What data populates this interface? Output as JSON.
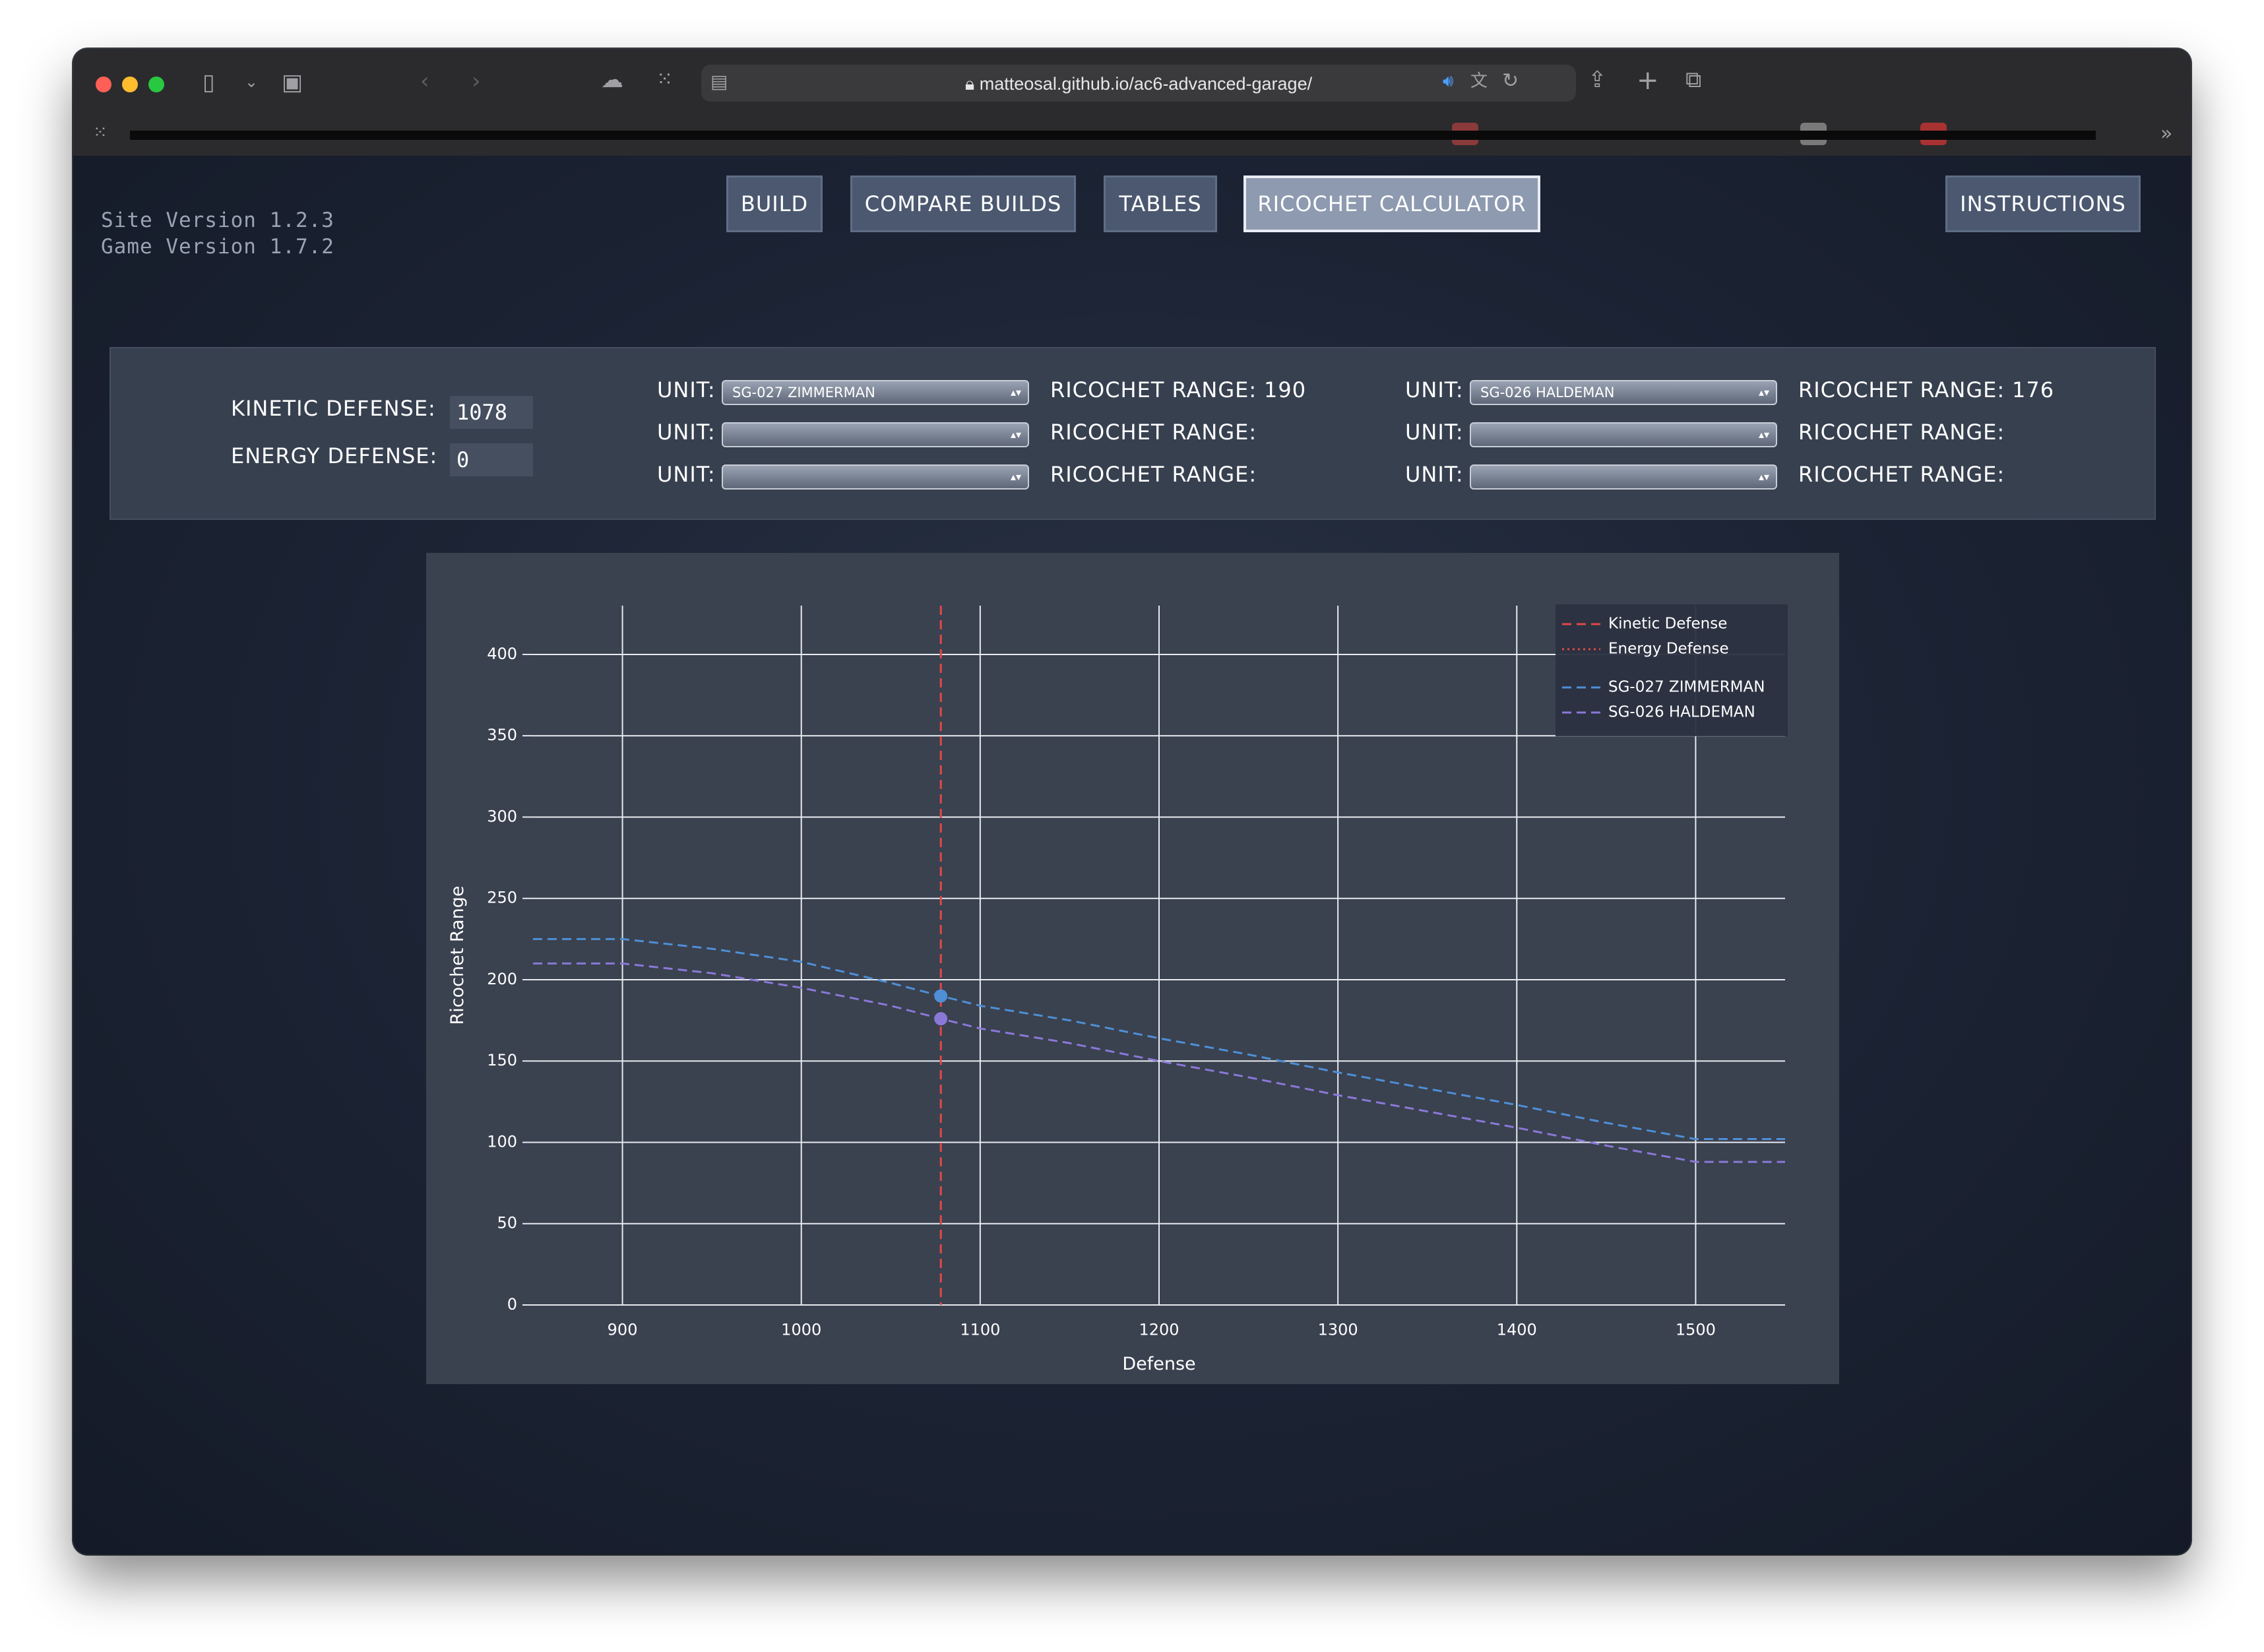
{
  "browser": {
    "url": "matteosal.github.io/ac6-advanced-garage/"
  },
  "site": {
    "site_version": "Site Version 1.2.3",
    "game_version": "Game Version 1.7.2"
  },
  "nav": {
    "build": "BUILD",
    "compare": "COMPARE BUILDS",
    "tables": "TABLES",
    "ricochet": "RICOCHET CALCULATOR",
    "instructions": "INSTRUCTIONS"
  },
  "controls": {
    "kinetic_label": "KINETIC DEFENSE:",
    "kinetic_value": "1078",
    "energy_label": "ENERGY DEFENSE:",
    "energy_value": "0",
    "unit_label": "UNIT:",
    "range_label": "RICOCHET RANGE:",
    "left": [
      {
        "unit": "SG-027 ZIMMERMAN",
        "range": "190"
      },
      {
        "unit": "",
        "range": ""
      },
      {
        "unit": "",
        "range": ""
      }
    ],
    "right": [
      {
        "unit": "SG-026 HALDEMAN",
        "range": "176"
      },
      {
        "unit": "",
        "range": ""
      },
      {
        "unit": "",
        "range": ""
      }
    ]
  },
  "chart_data": {
    "type": "line",
    "xlabel": "Defense",
    "ylabel": "Ricochet Range",
    "xlim": [
      850,
      1550
    ],
    "ylim": [
      0,
      430
    ],
    "xticks": [
      900,
      1000,
      1100,
      1200,
      1300,
      1400,
      1500
    ],
    "yticks": [
      0,
      50,
      100,
      150,
      200,
      250,
      300,
      350,
      400
    ],
    "grid": true,
    "legend_position": "top-right",
    "legend": [
      "Kinetic Defense",
      "Energy Defense",
      "SG-027 ZIMMERMAN",
      "SG-026 HALDEMAN"
    ],
    "vlines": [
      {
        "name": "Kinetic Defense",
        "x": 1078,
        "color": "#e04848",
        "dash": "dashed"
      },
      {
        "name": "Energy Defense",
        "x": 0,
        "color": "#e04848",
        "dash": "dotted"
      }
    ],
    "series": [
      {
        "name": "SG-027 ZIMMERMAN",
        "color": "#4e8fd6",
        "x": [
          850,
          900,
          950,
          1000,
          1050,
          1078,
          1100,
          1150,
          1200,
          1250,
          1300,
          1350,
          1400,
          1450,
          1500,
          1550
        ],
        "y": [
          225,
          225,
          219,
          211,
          198,
          190,
          184,
          175,
          164,
          154,
          143,
          133,
          123,
          112,
          102,
          102
        ]
      },
      {
        "name": "SG-026 HALDEMAN",
        "color": "#8a78d8",
        "x": [
          850,
          900,
          950,
          1000,
          1050,
          1078,
          1100,
          1150,
          1200,
          1250,
          1300,
          1350,
          1400,
          1450,
          1500,
          1550
        ],
        "y": [
          210,
          210,
          204,
          195,
          184,
          176,
          170,
          161,
          150,
          140,
          129,
          119,
          109,
          98,
          88,
          88
        ]
      }
    ],
    "markers": [
      {
        "series": "SG-027 ZIMMERMAN",
        "x": 1078,
        "y": 190
      },
      {
        "series": "SG-026 HALDEMAN",
        "x": 1078,
        "y": 176
      }
    ]
  },
  "colors": {
    "page_bg": "#1d2536",
    "panel_bg": "#37404f",
    "button_bg": "#4b5870",
    "button_active_bg": "#8e9ab0",
    "chart_bg": "#3a414f"
  }
}
